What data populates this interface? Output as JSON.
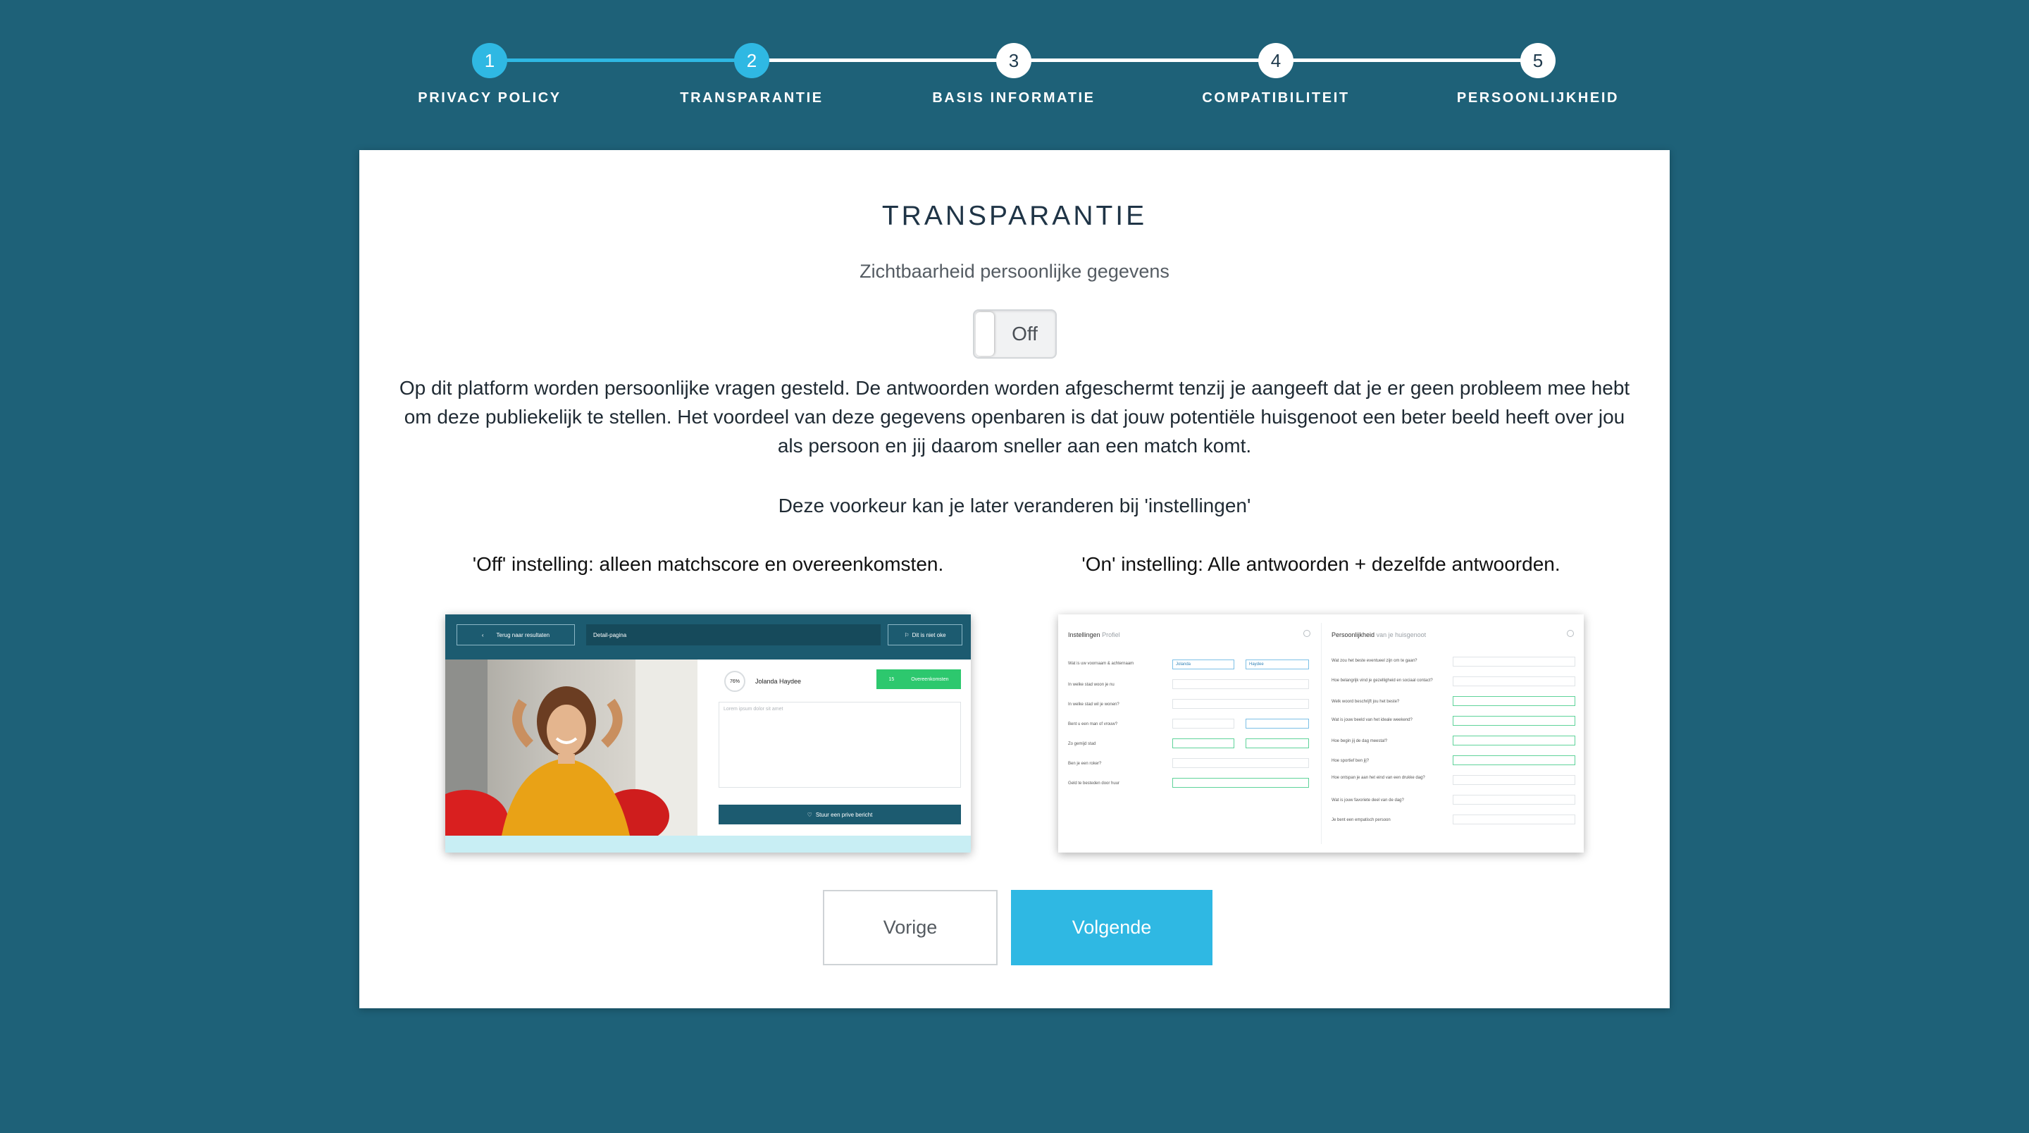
{
  "stepper": {
    "steps": [
      {
        "number": "1",
        "label": "PRIVACY POLICY"
      },
      {
        "number": "2",
        "label": "TRANSPARANTIE"
      },
      {
        "number": "3",
        "label": "BASIS INFORMATIE"
      },
      {
        "number": "4",
        "label": "COMPATIBILITEIT"
      },
      {
        "number": "5",
        "label": "PERSOONLIJKHEID"
      }
    ],
    "completed_steps": 2,
    "colors": {
      "active": "#2fb8e3",
      "inactive_line": "#ffffff",
      "inactive_circle": "#ffffff"
    }
  },
  "card": {
    "title": "TRANSPARANTIE",
    "subtitle": "Zichtbaarheid persoonlijke gegevens",
    "toggle_label": "Off",
    "description": "Op dit platform worden persoonlijke vragen gesteld. De antwoorden worden afgeschermt tenzij je aangeeft dat je er geen probleem mee hebt om deze publiekelijk te stellen. Het voordeel van deze gegevens openbaren is dat jouw potentiële huisgenoot een beter beeld heeft over jou als persoon en jij daarom sneller aan een match komt.",
    "preference_note": "Deze voorkeur kan je later veranderen bij 'instellingen'",
    "off_caption": "'Off' instelling: alleen matchscore en overeenkomsten.",
    "on_caption": "'On' instelling: Alle antwoorden + dezelfde antwoorden."
  },
  "preview_off": {
    "back_button": "Terug naar resultaten",
    "page_label": "Detail-pagina",
    "right_button": "Dit is niet oke",
    "score": "76%",
    "name": "Jolanda Haydee",
    "match_count": "15",
    "match_label": "Overeenkomsten",
    "textarea_placeholder": "Lorem ipsum dolor sit amet",
    "send_button": "Stuur een prive bericht"
  },
  "preview_on": {
    "left_title": "Instellingen",
    "left_title_muted": "Profiel",
    "right_title": "Persoonlijkheid",
    "right_title_muted": "van je huisgenoot",
    "left_rows": [
      "Wat is uw voornaam & achternaam",
      "In welke stad woon je nu",
      "In welke stad wil je wonen?",
      "Bent u een man of vrouw?",
      "Zo gemijd stad",
      "Ben je een roker?",
      "Geld te besteden door huur"
    ],
    "right_rows": [
      "Wat zou het beste eventueel zijn om te gaan?",
      "Hoe belangrijk vind je gezelligheid en sociaal contact?",
      "Welk woord beschrijft jou het beste?",
      "Wat is jouw beeld van het ideale weekend?",
      "Hoe begin jij de dag meestal?",
      "Hoe sportief ben jij?",
      "Hoe ontspan je aan het eind van een drukke dag?",
      "Wat is jouw favoriete deel van de dag?",
      "Je bent een empatisch persoon"
    ],
    "first_name": "Jolanda",
    "last_name": "Haydee"
  },
  "buttons": {
    "previous": "Vorige",
    "next": "Volgende"
  }
}
